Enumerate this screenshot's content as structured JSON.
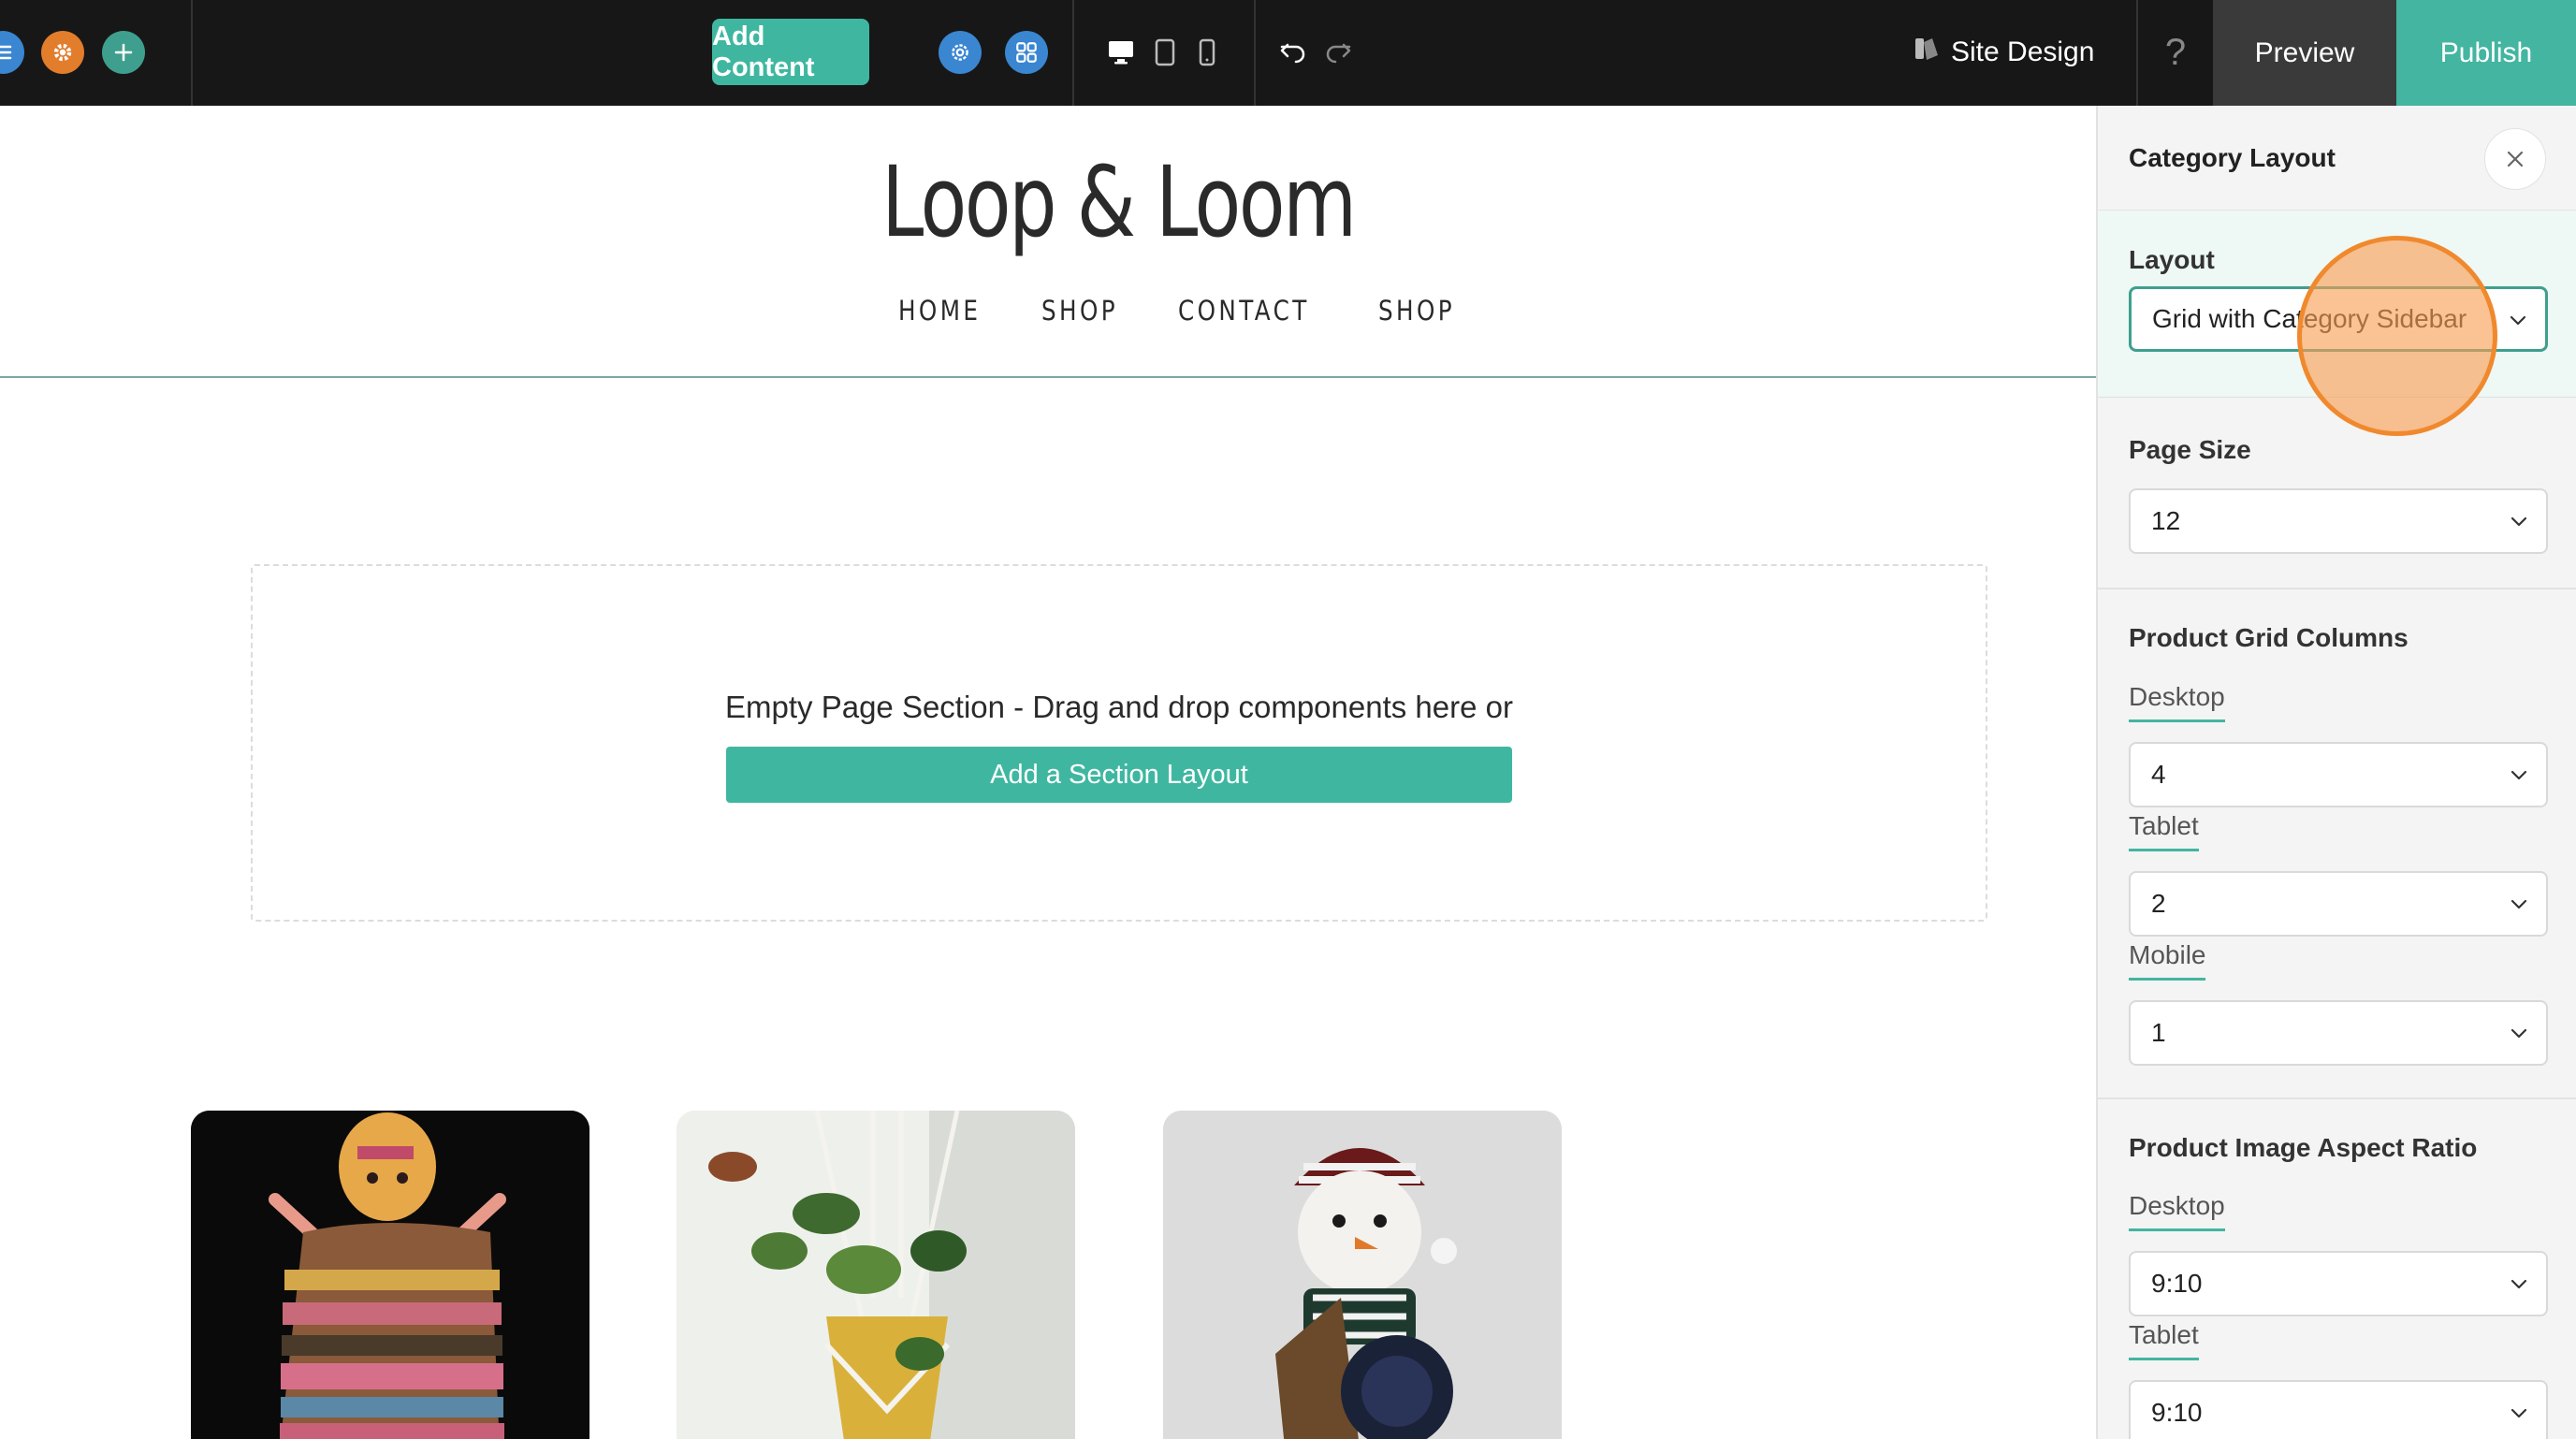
{
  "toolbar": {
    "add_content_label": "Add Content",
    "site_design_label": "Site Design",
    "help_label": "?",
    "preview_label": "Preview",
    "publish_label": "Publish"
  },
  "site": {
    "title": "Loop & Loom",
    "nav": [
      "HOME",
      "SHOP",
      "CONTACT",
      "SHOP"
    ],
    "empty_section_text": "Empty Page Section - Drag and drop components here or",
    "add_section_label": "Add a Section Layout"
  },
  "panel": {
    "title": "Category Layout",
    "layout": {
      "label": "Layout",
      "value": "Grid with Category Sidebar"
    },
    "page_size": {
      "label": "Page Size",
      "value": "12"
    },
    "grid_columns": {
      "label": "Product Grid Columns",
      "desktop_label": "Desktop",
      "desktop_value": "4",
      "tablet_label": "Tablet",
      "tablet_value": "2",
      "mobile_label": "Mobile",
      "mobile_value": "1"
    },
    "aspect_ratio": {
      "label": "Product Image Aspect Ratio",
      "desktop_label": "Desktop",
      "desktop_value": "9:10",
      "tablet_label": "Tablet",
      "tablet_value": "9:10"
    }
  },
  "colors": {
    "accent": "#43b5a0",
    "toolbar_bg": "#171717",
    "highlight": "#f89c50"
  }
}
